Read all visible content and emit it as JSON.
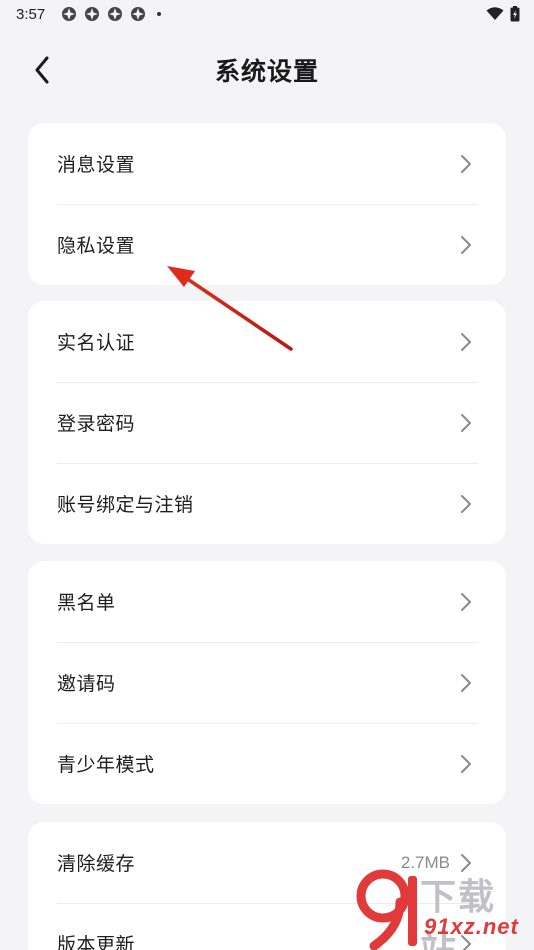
{
  "status_bar": {
    "time": "3:57",
    "app_icons": [
      "app-icon",
      "app-icon",
      "app-icon",
      "app-icon"
    ],
    "wifi_icon": "wifi-icon",
    "battery_icon": "battery-icon"
  },
  "header": {
    "title": "系统设置",
    "back_icon": "back-arrow-icon"
  },
  "groups": [
    {
      "items": [
        {
          "label": "消息设置"
        },
        {
          "label": "隐私设置"
        }
      ]
    },
    {
      "items": [
        {
          "label": "实名认证"
        },
        {
          "label": "登录密码"
        },
        {
          "label": "账号绑定与注销"
        }
      ]
    },
    {
      "items": [
        {
          "label": "黑名单"
        },
        {
          "label": "邀请码"
        },
        {
          "label": "青少年模式"
        }
      ]
    },
    {
      "items": [
        {
          "label": "清除缓存",
          "value": "2.7MB"
        },
        {
          "label": "版本更新"
        }
      ]
    }
  ],
  "annotation": {
    "color": "#d8261e",
    "points_to": "隐私设置"
  },
  "watermark": {
    "line1": "下载站",
    "line2": "91xz.net",
    "accent": "#e03a3a"
  }
}
